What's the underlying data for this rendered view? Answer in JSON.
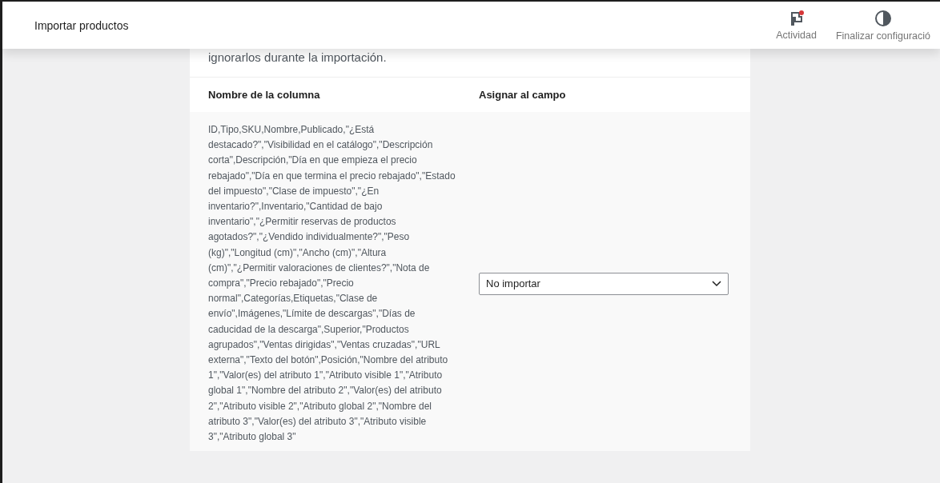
{
  "header": {
    "title": "Importar productos",
    "actions": [
      {
        "kind": "activity",
        "label": "Actividad",
        "notification": true
      },
      {
        "kind": "setup",
        "label": "Finalizar configuració"
      }
    ]
  },
  "intro": "ignorarlos durante la importación.",
  "mapping": {
    "columns": [
      "Nombre de la columna",
      "Asignar al campo"
    ],
    "rows": [
      {
        "column_name": "ID,Tipo,SKU,Nombre,Publicado,\"¿Está destacado?\",\"Visibilidad en el catálogo\",\"Descripción corta\",Descripción,\"Día en que empieza el precio rebajado\",\"Día en que termina el precio rebajado\",\"Estado del impuesto\",\"Clase de impuesto\",\"¿En inventario?\",Inventario,\"Cantidad de bajo inventario\",\"¿Permitir reservas de productos agotados?\",\"¿Vendido individualmente?\",\"Peso (kg)\",\"Longitud (cm)\",\"Ancho (cm)\",\"Altura (cm)\",\"¿Permitir valoraciones de clientes?\",\"Nota de compra\",\"Precio rebajado\",\"Precio normal\",Categorías,Etiquetas,\"Clase de envío\",Imágenes,\"Límite de descargas\",\"Días de caducidad de la descarga\",Superior,\"Productos agrupados\",\"Ventas dirigidas\",\"Ventas cruzadas\",\"URL externa\",\"Texto del botón\",Posición,\"Nombre del atributo 1\",\"Valor(es) del atributo 1\",\"Atributo visible 1\",\"Atributo global 1\",\"Nombre del atributo 2\",\"Valor(es) del atributo 2\",\"Atributo visible 2\",\"Atributo global 2\",\"Nombre del atributo 3\",\"Valor(es) del atributo 3\",\"Atributo visible 3\",\"Atributo global 3\"",
        "field": "No importar"
      }
    ]
  }
}
